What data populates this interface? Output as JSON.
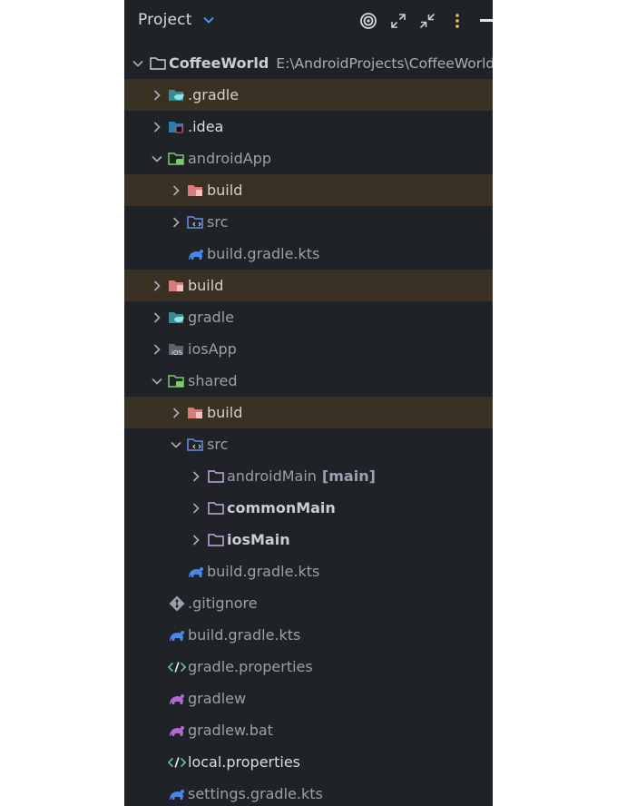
{
  "panel": {
    "title": "Project",
    "toolbar": [
      {
        "name": "target-icon"
      },
      {
        "name": "expand-all-icon"
      },
      {
        "name": "collapse-all-icon"
      },
      {
        "name": "more-options-icon"
      },
      {
        "name": "minimize-icon"
      }
    ]
  },
  "tree": [
    {
      "label": "CoffeeWorld",
      "path": "E:\\AndroidProjects\\CoffeeWorld",
      "depth": 0,
      "arrow": "open",
      "icon": "module-folder-icon",
      "style": "bold-dim"
    },
    {
      "label": ".gradle",
      "depth": 1,
      "arrow": "closed",
      "icon": "gradle-folder-icon",
      "highlight": true,
      "style": "excl"
    },
    {
      "label": ".idea",
      "depth": 1,
      "arrow": "closed",
      "icon": "idea-folder-icon",
      "style": "mod"
    },
    {
      "label": "androidApp",
      "depth": 1,
      "arrow": "open",
      "icon": "android-module-icon",
      "style": "dim"
    },
    {
      "label": "build",
      "depth": 2,
      "arrow": "closed",
      "icon": "excluded-folder-icon",
      "highlight": true,
      "style": "excl"
    },
    {
      "label": "src",
      "depth": 2,
      "arrow": "closed",
      "icon": "source-folder-icon",
      "style": "dim"
    },
    {
      "label": "build.gradle.kts",
      "depth": 2,
      "arrow": "none",
      "icon": "gradle-elephant-icon",
      "style": "dim"
    },
    {
      "label": "build",
      "depth": 1,
      "arrow": "closed",
      "icon": "excluded-folder-icon",
      "highlight": true,
      "style": "excl"
    },
    {
      "label": "gradle",
      "depth": 1,
      "arrow": "closed",
      "icon": "gradle-folder-icon",
      "style": "dim"
    },
    {
      "label": "iosApp",
      "depth": 1,
      "arrow": "closed",
      "icon": "ios-folder-icon",
      "style": "dim"
    },
    {
      "label": "shared",
      "depth": 1,
      "arrow": "open",
      "icon": "shared-module-icon",
      "style": "dim"
    },
    {
      "label": "build",
      "depth": 2,
      "arrow": "closed",
      "icon": "excluded-folder-icon",
      "highlight": true,
      "style": "excl"
    },
    {
      "label": "src",
      "depth": 2,
      "arrow": "open",
      "icon": "source-folder-icon",
      "style": "dim"
    },
    {
      "label": "androidMain",
      "tag": "[main]",
      "depth": 3,
      "arrow": "closed",
      "icon": "folder-icon",
      "style": "dim"
    },
    {
      "label": "commonMain",
      "depth": 3,
      "arrow": "closed",
      "icon": "folder-icon",
      "style": "bold"
    },
    {
      "label": "iosMain",
      "depth": 3,
      "arrow": "closed",
      "icon": "folder-icon",
      "style": "bold"
    },
    {
      "label": "build.gradle.kts",
      "depth": 2,
      "arrow": "none",
      "icon": "gradle-elephant-icon",
      "style": "dim"
    },
    {
      "label": ".gitignore",
      "depth": 1,
      "arrow": "none",
      "icon": "git-icon",
      "style": "dim"
    },
    {
      "label": "build.gradle.kts",
      "depth": 1,
      "arrow": "none",
      "icon": "gradle-elephant-icon",
      "style": "dim"
    },
    {
      "label": "gradle.properties",
      "depth": 1,
      "arrow": "none",
      "icon": "properties-icon",
      "style": "dim"
    },
    {
      "label": "gradlew",
      "depth": 1,
      "arrow": "none",
      "icon": "gradle-script-icon",
      "style": "dim"
    },
    {
      "label": "gradlew.bat",
      "depth": 1,
      "arrow": "none",
      "icon": "gradle-script-icon",
      "style": "dim"
    },
    {
      "label": "local.properties",
      "depth": 1,
      "arrow": "none",
      "icon": "properties-icon",
      "style": "mod"
    },
    {
      "label": "settings.gradle.kts",
      "depth": 1,
      "arrow": "none",
      "icon": "gradle-elephant-icon",
      "style": "dim"
    }
  ]
}
